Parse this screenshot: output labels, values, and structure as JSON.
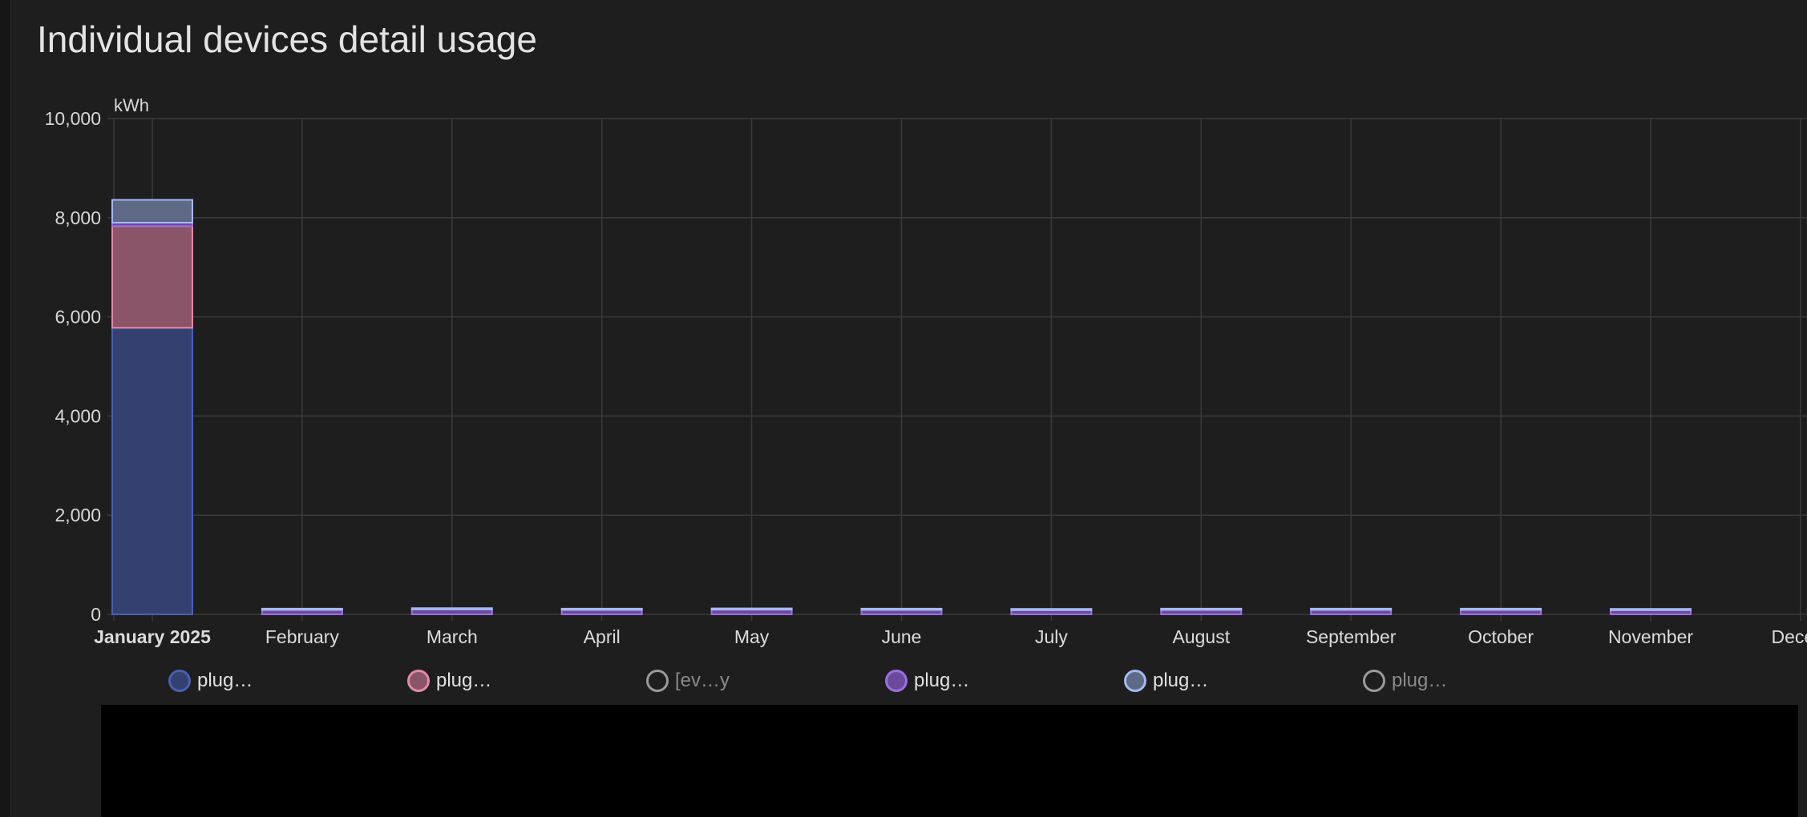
{
  "title": "Individual devices detail usage",
  "chart_data": {
    "type": "bar",
    "stacked": true,
    "ylabel": "kWh",
    "ylim": [
      0,
      10000
    ],
    "yticks": [
      "0",
      "2,000",
      "4,000",
      "6,000",
      "8,000",
      "10,000"
    ],
    "ytick_values": [
      0,
      2000,
      4000,
      6000,
      8000,
      10000
    ],
    "categories": [
      "January 2025",
      "February",
      "March",
      "April",
      "May",
      "June",
      "July",
      "August",
      "September",
      "October",
      "November",
      "Decem"
    ],
    "series": [
      {
        "name": "plug…",
        "color": "#4a5fb3",
        "fill": "#34406f",
        "values": [
          5780,
          0,
          0,
          0,
          0,
          0,
          0,
          0,
          0,
          0,
          0,
          0
        ]
      },
      {
        "name": "plug…",
        "color": "#e38aa8",
        "fill": "#8a5569",
        "values": [
          2050,
          0,
          0,
          0,
          0,
          0,
          0,
          0,
          0,
          0,
          0,
          0
        ]
      },
      {
        "name": "[ev…y",
        "color": "#9a9a9a",
        "fill": "none",
        "hidden": true,
        "values": [
          0,
          0,
          0,
          0,
          0,
          0,
          0,
          0,
          0,
          0,
          0,
          0
        ]
      },
      {
        "name": "plug…",
        "color": "#9b6fe0",
        "fill": "#6b4a9e",
        "values": [
          70,
          90,
          100,
          90,
          95,
          90,
          85,
          90,
          90,
          90,
          85,
          0
        ]
      },
      {
        "name": "plug…",
        "color": "#a6b8f0",
        "fill": "#5e6a85",
        "values": [
          460,
          25,
          25,
          25,
          25,
          25,
          25,
          25,
          25,
          25,
          25,
          0
        ]
      },
      {
        "name": "plug…",
        "color": "#9a9a9a",
        "fill": "none",
        "hidden": true,
        "values": [
          0,
          0,
          0,
          0,
          0,
          0,
          0,
          0,
          0,
          0,
          0,
          0
        ]
      }
    ],
    "legend_position": "bottom",
    "grid": true
  }
}
